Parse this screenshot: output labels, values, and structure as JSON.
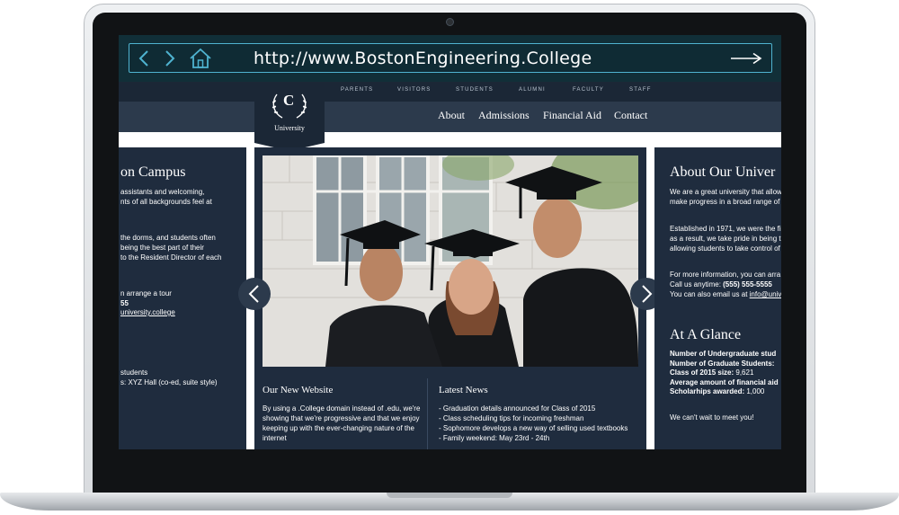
{
  "browser": {
    "url": "http://www.BostonEngineering.College"
  },
  "site": {
    "logo_letter": "C",
    "logo_name": "University",
    "top_nav": [
      "PARENTS",
      "VISITORS",
      "STUDENTS",
      "ALUMNI",
      "FACULTY",
      "STAFF"
    ],
    "main_nav": [
      "About",
      "Admissions",
      "Financial Aid",
      "Contact"
    ]
  },
  "left_col": {
    "title": "on Campus",
    "lines": [
      "assistants and welcoming,",
      "nts of all backgrounds feel at",
      "",
      "the dorms, and students often",
      "being the best part of their",
      "to the Resident Director of each",
      "",
      "n arrange a tour",
      "55",
      "university.college",
      "",
      "students",
      "s: XYZ Hall (co-ed, suite style)"
    ]
  },
  "center": {
    "website_title": "Our New Website",
    "website_lines": [
      "By using a .College domain instead of .edu, we're",
      "showing that we're progressive and that we enjoy",
      "keeping up with the ever-changing nature of the",
      "internet"
    ],
    "news_title": "Latest News",
    "news_items": [
      "-  Graduation details announced for Class of 2015",
      "-  Class scheduling tips for incoming freshman",
      "-  Sophomore develops a new way of selling used textbooks",
      "-  Family weekend: May 23rd - 24th"
    ]
  },
  "right_col": {
    "about_title": "About Our Univer",
    "about_lines": [
      "We are a great university that allow",
      "make progress in a broad range of",
      "",
      "Established in 1971, we were the fi",
      "as a result, we take pride in being t",
      "allowing students to take control of",
      "",
      "For more information, you can arra",
      "Call us anytime: ",
      "You can also email us at "
    ],
    "phone": "(555) 555-5555",
    "email": "info@univ",
    "glance_title": "At A Glance",
    "glance_lines": [
      {
        "label": "Number of Undergraduate stud",
        "value": ""
      },
      {
        "label": "Number of Graduate Students:",
        "value": ""
      },
      {
        "label": "Class of 2015 size: ",
        "value": "9,621"
      },
      {
        "label": "Average amount of financial aid",
        "value": ""
      },
      {
        "label": "Scholarhips awarded: ",
        "value": "1,000"
      }
    ],
    "closing": "We can't wait to meet you!"
  },
  "colors": {
    "browser_bar": "#112f38",
    "url_accent": "#4fb3d0",
    "navy_dark": "#1b2736",
    "navy_mid": "#2c3a4c",
    "panel": "#1f2c3e"
  },
  "icons": [
    "back-arrow-icon",
    "forward-arrow-icon",
    "home-icon",
    "go-arrow-icon",
    "laurel-icon",
    "slider-prev-icon",
    "slider-next-icon"
  ]
}
